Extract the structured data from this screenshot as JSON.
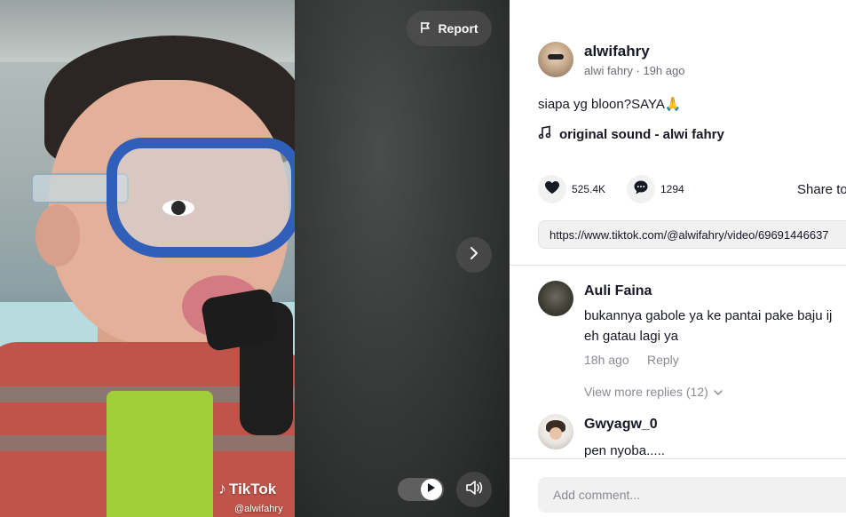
{
  "video": {
    "report_label": "Report",
    "watermark_brand": "TikTok",
    "watermark_handle": "@alwifahry"
  },
  "author": {
    "username": "alwifahry",
    "display_name": "alwi fahry",
    "time_ago": "19h ago",
    "subline": "alwi fahry · 19h ago"
  },
  "post": {
    "caption": "siapa yg bloon?SAYA🙏",
    "sound": "original sound - alwi fahry",
    "likes": "525.4K",
    "comments": "1294",
    "share_label": "Share to",
    "link": "https://www.tiktok.com/@alwifahry/video/69691446637"
  },
  "comments": [
    {
      "name": "Auli Faina",
      "text_line1": "bukannya gabole ya ke pantai pake baju ij",
      "text_line2": "eh gatau lagi ya",
      "time": "18h ago",
      "reply_label": "Reply",
      "more_replies": "View more replies (12)"
    },
    {
      "name": "Gwyagw_0",
      "text_line1": "pen nyoba....."
    }
  ],
  "composer": {
    "placeholder": "Add comment..."
  },
  "colors": {
    "text_primary": "#161823",
    "text_secondary": "#8a8b91",
    "chip_bg": "#f1f1f2"
  }
}
